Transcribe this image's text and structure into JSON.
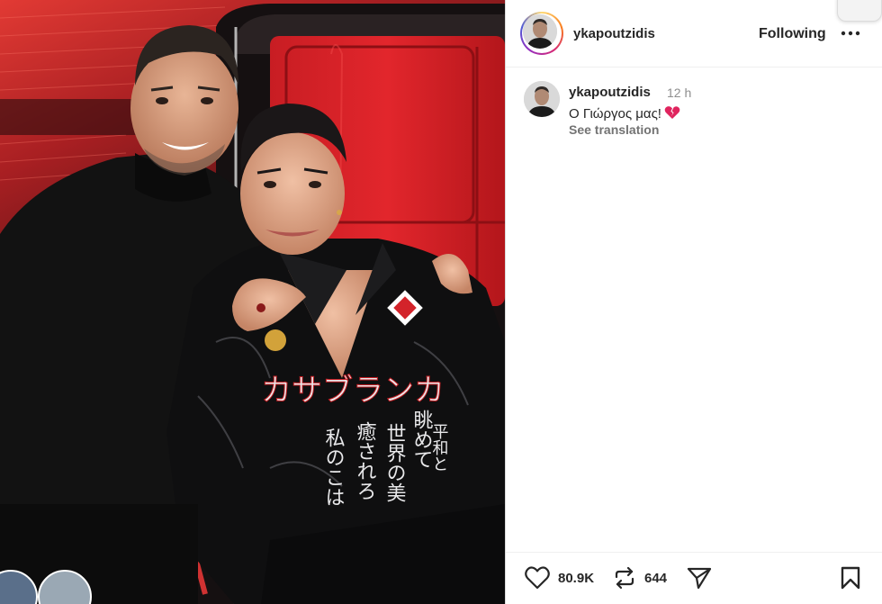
{
  "post": {
    "author": "ykapoutzidis",
    "follow_label": "Following",
    "caption": {
      "username": "ykapoutzidis",
      "time": "12 h",
      "text": "Ο Γιώργος μας!",
      "emoji_icon": "broken-heart-icon",
      "translate_label": "See translation"
    },
    "stats": {
      "likes": "80.9K",
      "reposts": "644"
    }
  },
  "icons": {
    "more": "more-options-icon",
    "like": "heart-icon",
    "repost": "repost-icon",
    "share": "send-icon",
    "save": "bookmark-icon"
  },
  "photo": {
    "shirt_text_1": "カサブランカ",
    "shirt_text_2": "平和と",
    "shirt_text_3": "世界の美",
    "shirt_text_4": "私のこは",
    "shirt_text_5": "癒されろ",
    "shirt_text_6": "眺めて"
  },
  "colors": {
    "brand_ring": "#d62976",
    "broken_heart": "#e0245e",
    "text": "#262626",
    "muted": "#8e8e8e"
  }
}
